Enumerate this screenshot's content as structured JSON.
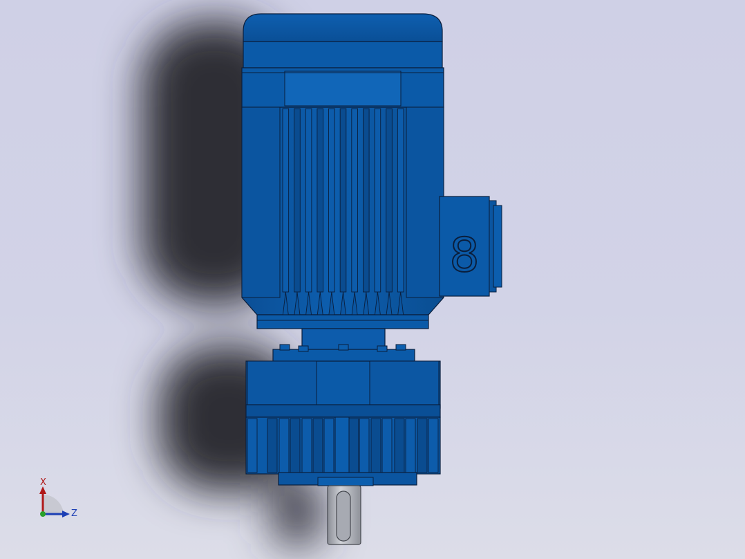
{
  "viewport": {
    "background_top": "#cfd0e6",
    "background_bottom": "#dcdde8"
  },
  "model": {
    "body_color": "#0a5aa6",
    "body_dark": "#0a3c78",
    "body_light": "#1b72c2",
    "edge_color": "#0a1e3c",
    "shaft_color": "#b9bcc4",
    "terminal_box_mark": "8"
  },
  "triad": {
    "x_label": "X",
    "z_label": "Z",
    "x_color": "#b01818",
    "z_color": "#1c3fb5",
    "y_color": "#2aa02a"
  }
}
